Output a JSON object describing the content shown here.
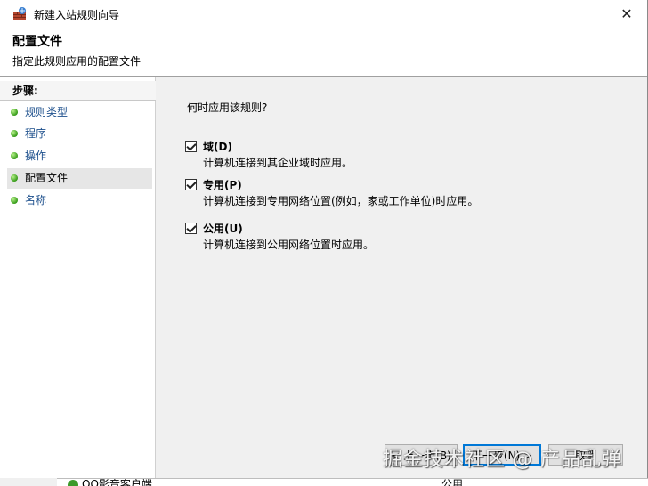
{
  "window": {
    "title": "新建入站规则向导",
    "close_glyph": "✕"
  },
  "header": {
    "title": "配置文件",
    "subtitle": "指定此规则应用的配置文件"
  },
  "steps": {
    "heading": "步骤:",
    "items": [
      {
        "label": "规则类型"
      },
      {
        "label": "程序"
      },
      {
        "label": "操作"
      },
      {
        "label": "配置文件"
      },
      {
        "label": "名称"
      }
    ],
    "active_index": 3
  },
  "main": {
    "question": "何时应用该规则?",
    "options": [
      {
        "label": "域(D)",
        "description": "计算机连接到其企业域时应用。",
        "checked": true
      },
      {
        "label": "专用(P)",
        "description": "计算机连接到专用网络位置(例如，家或工作单位)时应用。",
        "checked": true
      },
      {
        "label": "公用(U)",
        "description": "计算机连接到公用网络位置时应用。",
        "checked": true
      }
    ]
  },
  "buttons": {
    "back": "< 上一步(B)",
    "next": "下一步(N) >",
    "cancel": "取消"
  },
  "background_window": {
    "row_text": "QQ影音客户端",
    "row_profile": "公用"
  },
  "watermark": "掘金技术社区 @ 产品乱弹",
  "colors": {
    "step_link": "#1c4f8c",
    "dot_green": "#3ca01e",
    "primary_border": "#0078d7"
  },
  "icons": {
    "app": "firewall-wall-icon",
    "step_bullet": "green-dot-icon",
    "check": "checkmark-icon"
  }
}
